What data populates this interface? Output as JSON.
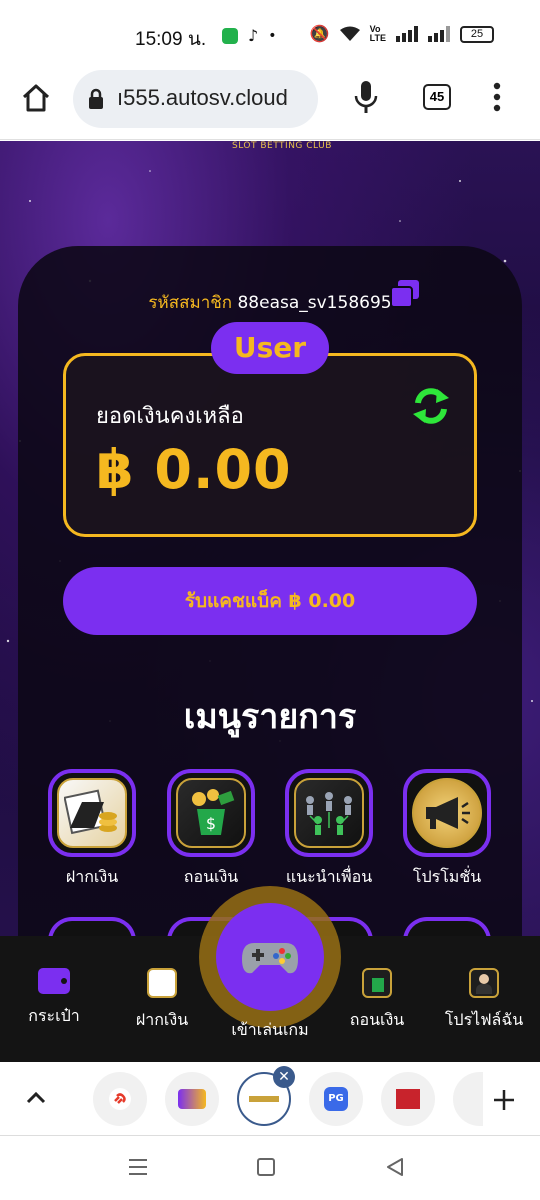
{
  "status_bar": {
    "time": "15:09 น.",
    "battery": "25"
  },
  "browser": {
    "url": "ı555.autosv.cloud",
    "tab_count": "45"
  },
  "site": {
    "logo_tagline": "SLOT BETTING CLUB"
  },
  "account": {
    "member_label": "รหัสสมาชิก",
    "member_id": "88easa_sv158695",
    "role_badge": "User",
    "balance_label": "ยอดเงินคงเหลือ",
    "balance_value": "฿ 0.00",
    "cashback_button": "รับแคชแบ็ค ฿ 0.00"
  },
  "menu": {
    "title": "เมนูรายการ",
    "items": [
      {
        "label": "ฝากเงิน",
        "icon": "deposit-icon"
      },
      {
        "label": "ถอนเงิน",
        "icon": "withdraw-icon"
      },
      {
        "label": "แนะนำเพื่อน",
        "icon": "referral-icon"
      },
      {
        "label": "โปรโมชั่น",
        "icon": "megaphone-icon"
      }
    ]
  },
  "bottom_nav": {
    "items": [
      {
        "label": "กระเป๋า",
        "icon": "wallet-icon"
      },
      {
        "label": "ฝากเงิน",
        "icon": "deposit-icon"
      },
      {
        "label": "เข้าเล่นเกม",
        "icon": "gamepad-icon"
      },
      {
        "label": "ถอนเงิน",
        "icon": "withdraw-icon"
      },
      {
        "label": "โปรไฟล์ฉัน",
        "icon": "profile-icon"
      }
    ]
  },
  "tab_strip": {
    "chips": [
      "link-tab",
      "game-tab",
      "current-tab",
      "pg-tab",
      "red-tab"
    ],
    "pg_label": "PG"
  },
  "colors": {
    "accent_purple": "#7b2ff0",
    "accent_gold": "#f5b820",
    "refresh_green": "#2ee63a"
  }
}
